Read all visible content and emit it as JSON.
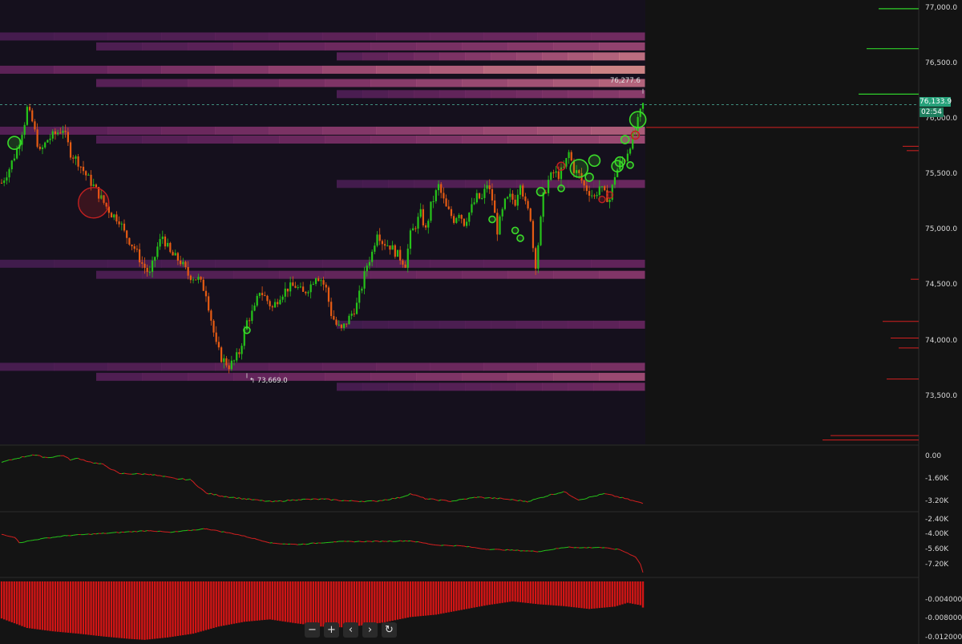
{
  "chart_data": [
    {
      "type": "candlestick",
      "title": "",
      "y_ticks": [
        "77,000.0",
        "76,500.0",
        "76,000.0",
        "75,500.0",
        "75,000.0",
        "74,500.0",
        "74,000.0",
        "73,500.0"
      ],
      "y_tick_values": [
        77000,
        76500,
        76000,
        75500,
        75000,
        74500,
        74000,
        73500
      ],
      "ylim": [
        73100,
        77050
      ],
      "last_price": 76133.9,
      "last_price_label": "76,133.9",
      "timer_label": "02:54",
      "high": 76277.6,
      "high_label": "76,277.6",
      "low": 73669.0,
      "low_label": "73,669.0",
      "colors": {
        "up": "#26c21a",
        "down": "#e55b13"
      },
      "close_path": [
        [
          0,
          75430
        ],
        [
          3,
          75560
        ],
        [
          6,
          75730
        ],
        [
          9,
          75980
        ],
        [
          10,
          76100
        ],
        [
          12,
          75980
        ],
        [
          15,
          75700
        ],
        [
          18,
          75820
        ],
        [
          21,
          75870
        ],
        [
          24,
          75920
        ],
        [
          27,
          75700
        ],
        [
          30,
          75620
        ],
        [
          33,
          75500
        ],
        [
          36,
          75400
        ],
        [
          40,
          75250
        ],
        [
          43,
          75150
        ],
        [
          46,
          75100
        ],
        [
          48,
          74980
        ],
        [
          52,
          74840
        ],
        [
          55,
          74700
        ],
        [
          58,
          74600
        ],
        [
          61,
          74850
        ],
        [
          63,
          74950
        ],
        [
          66,
          74790
        ],
        [
          70,
          74720
        ],
        [
          73,
          74600
        ],
        [
          77,
          74560
        ],
        [
          80,
          74440
        ],
        [
          82,
          74200
        ],
        [
          84,
          73960
        ],
        [
          86,
          73850
        ],
        [
          89,
          73780
        ],
        [
          91,
          73820
        ],
        [
          93,
          73900
        ],
        [
          96,
          74180
        ],
        [
          99,
          74290
        ],
        [
          101,
          74460
        ],
        [
          103,
          74400
        ],
        [
          106,
          74300
        ],
        [
          109,
          74420
        ],
        [
          112,
          74480
        ],
        [
          115,
          74500
        ],
        [
          118,
          74430
        ],
        [
          121,
          74510
        ],
        [
          123,
          74600
        ],
        [
          125,
          74560
        ],
        [
          127,
          74470
        ],
        [
          129,
          74250
        ],
        [
          131,
          74150
        ],
        [
          133,
          74100
        ],
        [
          136,
          74210
        ],
        [
          139,
          74330
        ],
        [
          141,
          74500
        ],
        [
          143,
          74690
        ],
        [
          145,
          74800
        ],
        [
          147,
          75000
        ],
        [
          149,
          74900
        ],
        [
          152,
          74860
        ],
        [
          155,
          74780
        ],
        [
          158,
          74700
        ],
        [
          160,
          74960
        ],
        [
          162,
          75050
        ],
        [
          164,
          75150
        ],
        [
          166,
          75000
        ],
        [
          168,
          75220
        ],
        [
          171,
          75400
        ],
        [
          174,
          75200
        ],
        [
          177,
          75100
        ],
        [
          179,
          75170
        ],
        [
          181,
          75070
        ],
        [
          183,
          75160
        ],
        [
          186,
          75300
        ],
        [
          188,
          75280
        ],
        [
          190,
          75420
        ],
        [
          192,
          75280
        ],
        [
          194,
          75000
        ],
        [
          197,
          75250
        ],
        [
          199,
          75300
        ],
        [
          201,
          75260
        ],
        [
          203,
          75450
        ],
        [
          205,
          75230
        ],
        [
          207,
          75120
        ],
        [
          208,
          74850
        ],
        [
          209,
          74700
        ],
        [
          210,
          74880
        ],
        [
          212,
          75300
        ],
        [
          214,
          75450
        ],
        [
          216,
          75520
        ],
        [
          218,
          75500
        ],
        [
          220,
          75560
        ],
        [
          222,
          75700
        ],
        [
          224,
          75550
        ],
        [
          226,
          75500
        ],
        [
          228,
          75400
        ],
        [
          230,
          75350
        ],
        [
          232,
          75300
        ],
        [
          234,
          75400
        ],
        [
          236,
          75320
        ],
        [
          238,
          75280
        ],
        [
          240,
          75500
        ],
        [
          242,
          75600
        ],
        [
          244,
          75650
        ],
        [
          246,
          75780
        ],
        [
          248,
          75900
        ],
        [
          250,
          76060
        ],
        [
          251,
          76133.9
        ]
      ],
      "order_levels": [
        [
          76750,
          0.35
        ],
        [
          76660,
          0.55
        ],
        [
          76570,
          0.8
        ],
        [
          76450,
          0.9
        ],
        [
          76330,
          0.75
        ],
        [
          76230,
          0.5
        ],
        [
          75900,
          0.7
        ],
        [
          75820,
          0.6
        ],
        [
          75420,
          0.3
        ],
        [
          74700,
          0.25
        ],
        [
          74600,
          0.45
        ],
        [
          74150,
          0.25
        ],
        [
          73770,
          0.4
        ],
        [
          73680,
          0.6
        ],
        [
          73590,
          0.35
        ]
      ],
      "bubbles_buy": [
        [
          5,
          75790,
          8
        ],
        [
          96,
          74100,
          4
        ],
        [
          192,
          75100,
          4
        ],
        [
          201,
          75000,
          4
        ],
        [
          203,
          74930,
          4
        ],
        [
          211,
          75350,
          5
        ],
        [
          219,
          75380,
          4
        ],
        [
          226,
          75560,
          11
        ],
        [
          230,
          75480,
          5
        ],
        [
          232,
          75630,
          7
        ],
        [
          241,
          75580,
          7
        ],
        [
          242,
          75620,
          6
        ],
        [
          244,
          75820,
          5
        ],
        [
          246,
          75590,
          4
        ],
        [
          249,
          76000,
          10
        ]
      ],
      "bubbles_sell": [
        [
          36,
          75250,
          19
        ],
        [
          219,
          75580,
          5
        ],
        [
          235,
          75280,
          4
        ],
        [
          238,
          75320,
          4
        ],
        [
          248,
          75860,
          5
        ]
      ],
      "side_levels_buy": [
        [
          77000,
          -50
        ],
        [
          76640,
          -65
        ],
        [
          76230,
          -75
        ]
      ],
      "side_levels_sell": [
        [
          75930,
          -340
        ],
        [
          75760,
          -20
        ],
        [
          75720,
          -15
        ],
        [
          74560,
          -10
        ],
        [
          74180,
          -45
        ],
        [
          74030,
          -35
        ],
        [
          73940,
          -25
        ],
        [
          73660,
          -40
        ],
        [
          73150,
          -110
        ],
        [
          73110,
          -120
        ]
      ]
    },
    {
      "type": "line",
      "title": "",
      "y_ticks": [
        "0.00",
        "-1.60K",
        "-3.20K"
      ],
      "y_tick_values": [
        0,
        -1600,
        -3200
      ],
      "ylim": [
        -3600,
        600
      ],
      "points": [
        [
          0,
          -350
        ],
        [
          6,
          -60
        ],
        [
          12,
          190
        ],
        [
          18,
          -10
        ],
        [
          24,
          150
        ],
        [
          27,
          -180
        ],
        [
          30,
          -60
        ],
        [
          35,
          -340
        ],
        [
          40,
          -520
        ],
        [
          46,
          -1150
        ],
        [
          58,
          -1200
        ],
        [
          68,
          -1520
        ],
        [
          74,
          -1600
        ],
        [
          80,
          -2550
        ],
        [
          86,
          -2760
        ],
        [
          96,
          -2990
        ],
        [
          106,
          -3180
        ],
        [
          116,
          -3020
        ],
        [
          126,
          -2990
        ],
        [
          136,
          -3120
        ],
        [
          146,
          -3140
        ],
        [
          156,
          -2880
        ],
        [
          160,
          -2600
        ],
        [
          166,
          -2970
        ],
        [
          176,
          -3140
        ],
        [
          186,
          -2850
        ],
        [
          196,
          -2960
        ],
        [
          206,
          -3160
        ],
        [
          214,
          -2720
        ],
        [
          220,
          -2450
        ],
        [
          226,
          -3040
        ],
        [
          236,
          -2600
        ],
        [
          244,
          -2950
        ],
        [
          251,
          -3300
        ]
      ]
    },
    {
      "type": "line",
      "title": "",
      "y_ticks": [
        "-2.40K",
        "-4.00K",
        "-5.60K",
        "-7.20K"
      ],
      "y_tick_values": [
        -2400,
        -4000,
        -5600,
        -7200
      ],
      "ylim": [
        -8100,
        -1900
      ],
      "points": [
        [
          0,
          -3900
        ],
        [
          5,
          -4200
        ],
        [
          7,
          -4800
        ],
        [
          15,
          -4400
        ],
        [
          25,
          -4050
        ],
        [
          40,
          -3800
        ],
        [
          58,
          -3500
        ],
        [
          66,
          -3700
        ],
        [
          80,
          -3300
        ],
        [
          92,
          -3900
        ],
        [
          106,
          -4850
        ],
        [
          116,
          -5000
        ],
        [
          130,
          -4700
        ],
        [
          150,
          -4650
        ],
        [
          160,
          -4600
        ],
        [
          170,
          -5050
        ],
        [
          180,
          -5150
        ],
        [
          190,
          -5500
        ],
        [
          200,
          -5600
        ],
        [
          210,
          -5750
        ],
        [
          222,
          -5250
        ],
        [
          226,
          -5350
        ],
        [
          234,
          -5300
        ],
        [
          242,
          -5550
        ],
        [
          248,
          -6300
        ],
        [
          250,
          -7100
        ],
        [
          251,
          -8000
        ]
      ]
    },
    {
      "type": "area",
      "title": "",
      "y_ticks": [
        "-0.004000",
        "-0.008000",
        "-0.012000"
      ],
      "y_tick_values": [
        -0.004,
        -0.008,
        -0.012
      ],
      "ylim": [
        -0.0125,
        0
      ],
      "points": [
        [
          0,
          -0.0078
        ],
        [
          10,
          -0.0098
        ],
        [
          20,
          -0.0105
        ],
        [
          30,
          -0.011
        ],
        [
          40,
          -0.0116
        ],
        [
          50,
          -0.0121
        ],
        [
          56,
          -0.0123
        ],
        [
          65,
          -0.0118
        ],
        [
          75,
          -0.011
        ],
        [
          85,
          -0.0095
        ],
        [
          95,
          -0.0085
        ],
        [
          105,
          -0.008
        ],
        [
          115,
          -0.0088
        ],
        [
          125,
          -0.0095
        ],
        [
          135,
          -0.0097
        ],
        [
          150,
          -0.0086
        ],
        [
          160,
          -0.0075
        ],
        [
          170,
          -0.007
        ],
        [
          180,
          -0.006
        ],
        [
          190,
          -0.005
        ],
        [
          200,
          -0.0042
        ],
        [
          210,
          -0.0048
        ],
        [
          220,
          -0.0052
        ],
        [
          230,
          -0.0058
        ],
        [
          240,
          -0.0053
        ],
        [
          245,
          -0.0045
        ],
        [
          250,
          -0.005
        ],
        [
          251,
          -0.0055
        ]
      ]
    }
  ],
  "toolbar": {
    "zoom_out": "−",
    "zoom_in": "+",
    "scroll_left": "‹",
    "scroll_right": "›",
    "reset": "↻"
  }
}
